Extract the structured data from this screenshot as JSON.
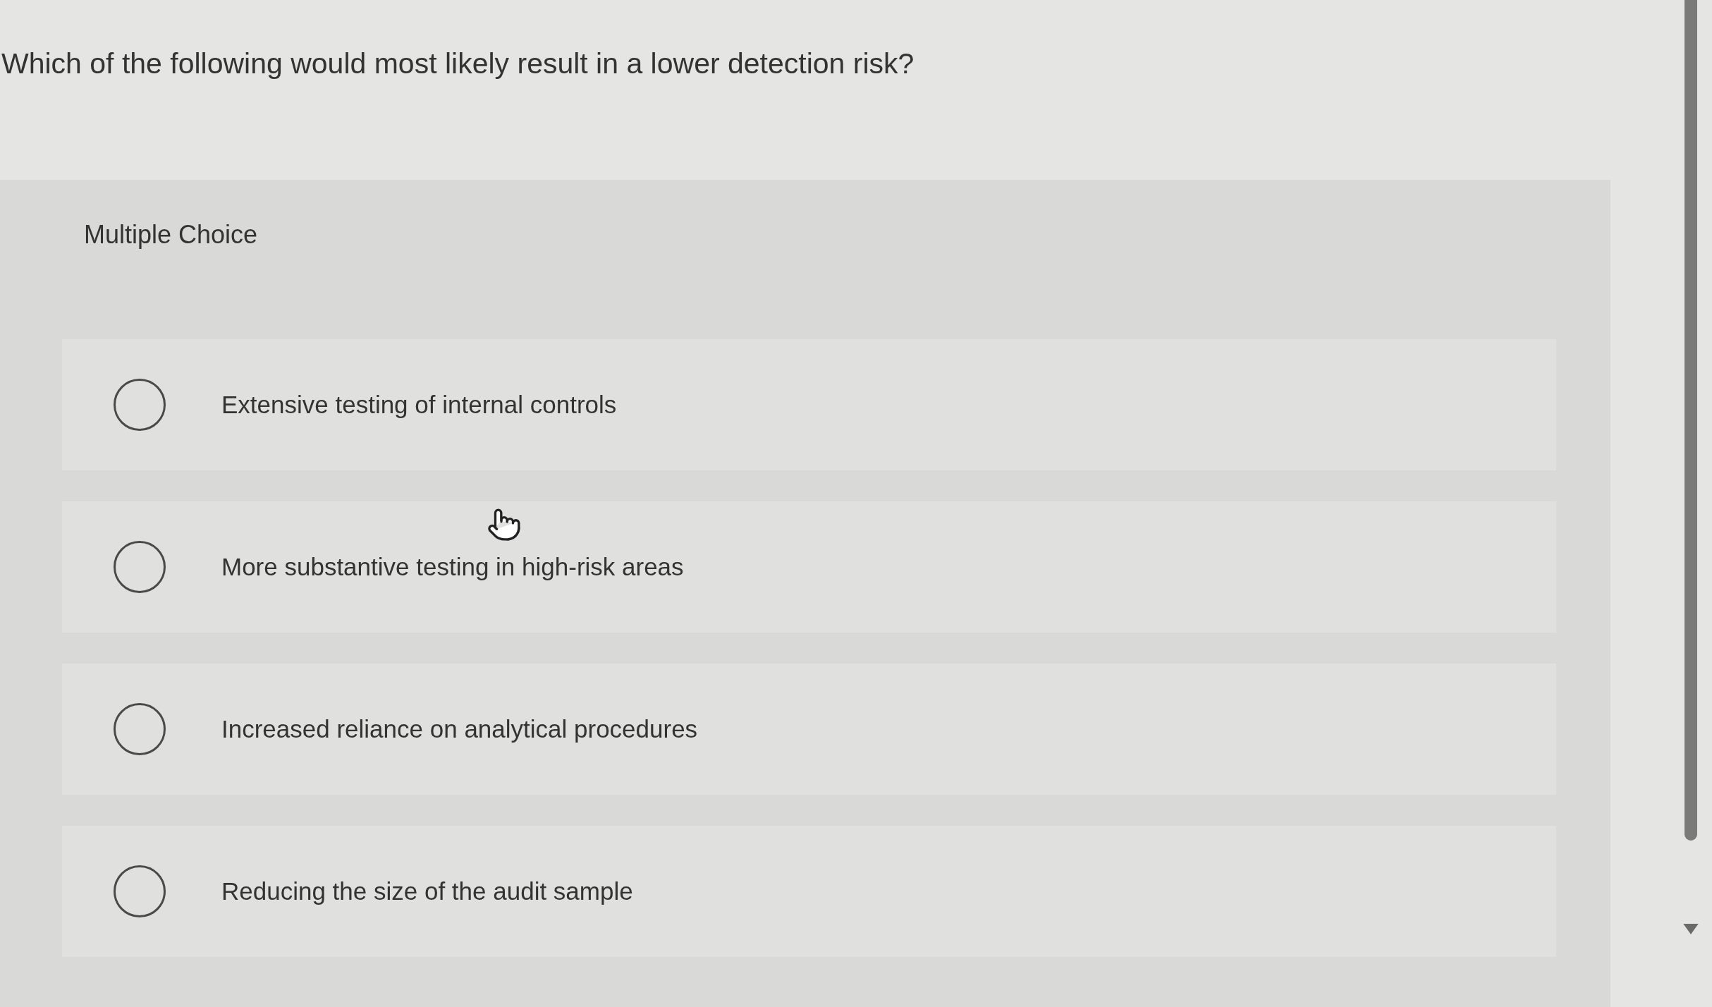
{
  "question": {
    "text": "Which of the following would most likely result in a lower detection risk?"
  },
  "answer_panel": {
    "label": "Multiple Choice",
    "options": [
      {
        "text": "Extensive testing of internal controls",
        "selected": false
      },
      {
        "text": "More substantive testing in high-risk areas",
        "selected": false
      },
      {
        "text": "Increased reliance on analytical procedures",
        "selected": false
      },
      {
        "text": "Reducing the size of the audit sample",
        "selected": false
      }
    ]
  }
}
